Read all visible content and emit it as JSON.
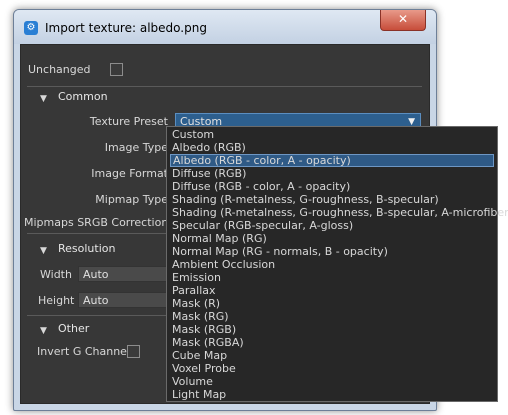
{
  "window": {
    "title": "Import texture: albedo.png",
    "close_glyph": "✕",
    "app_icon": "gear-icon"
  },
  "fields": {
    "unchanged": "Unchanged",
    "common": "Common",
    "texture_preset": "Texture Preset",
    "texture_preset_value": "Custom",
    "image_type": "Image Type",
    "image_format": "Image Format",
    "mipmap_type": "Mipmap Type",
    "mipmaps_srgb": "Mipmaps SRGB Correction",
    "resolution": "Resolution",
    "width": "Width",
    "width_value": "Auto",
    "height": "Height",
    "height_value": "Auto",
    "other": "Other",
    "invert_g": "Invert G Channel"
  },
  "dropdown": {
    "selected_index": 2,
    "options": [
      "Custom",
      "Albedo (RGB)",
      "Albedo (RGB - color, A - opacity)",
      "Diffuse (RGB)",
      "Diffuse (RGB - color, A - opacity)",
      "Shading (R-metalness, G-roughness, B-specular)",
      "Shading (R-metalness, G-roughness, B-specular, A-microfiber)",
      "Specular (RGB-specular, A-gloss)",
      "Normal Map (RG)",
      "Normal Map (RG - normals, B - opacity)",
      "Ambient Occlusion",
      "Emission",
      "Parallax",
      "Mask (R)",
      "Mask (RG)",
      "Mask (RGB)",
      "Mask (RGBA)",
      "Cube Map",
      "Voxel Probe",
      "Volume",
      "Light Map"
    ]
  }
}
